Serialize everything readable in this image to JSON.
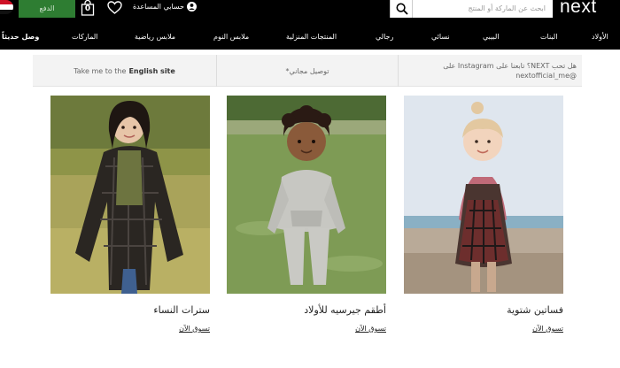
{
  "header": {
    "logo": "next",
    "search_placeholder": "ابحث عن الماركة أو المنتج",
    "account_label": "حسابي",
    "help_label": "المساعدة",
    "bag_count": "0",
    "checkout_label": "الدفع",
    "colors": {
      "background": "#000000",
      "checkout": "#2e7d32",
      "text": "#ffffff"
    }
  },
  "nav": {
    "items": [
      "الأولاد",
      "البنات",
      "البيبي",
      "نسائي",
      "رجالي",
      "المنتجات المنزلية",
      "ملابس النوم",
      "ملابس رياضية",
      "الماركات",
      "وصل حديثاً"
    ]
  },
  "promo": {
    "instagram_text": "هل تحب NEXT؟ تابعنا على Instagram على @nextofficial_me",
    "delivery_text": "توصيل مجاني*",
    "english_prefix": "Take me to the",
    "english_bold": "English site"
  },
  "tiles": [
    {
      "title": "فساتين شتوية",
      "shop_label": "تسوق الآن"
    },
    {
      "title": "أطقم جيرسيه للأولاد",
      "shop_label": "تسوق الآن"
    },
    {
      "title": "سترات النساء",
      "shop_label": "تسوق الآن"
    }
  ]
}
